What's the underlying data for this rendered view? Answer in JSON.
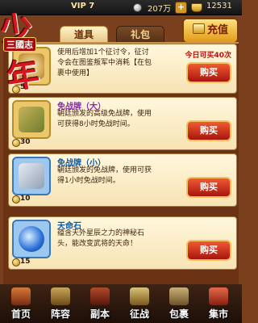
{
  "logo": {
    "main": "少年",
    "sub": "三國志"
  },
  "topbar": {
    "vip": "VIP 7",
    "silver": "207万",
    "plus_silver": "+",
    "gold": "12531"
  },
  "tabs": {
    "props": "道具",
    "gift": "礼包"
  },
  "recharge_label": "充值",
  "items": [
    {
      "name": "",
      "desc": "使用后增加1个征讨令，征讨令会在图鉴叛军中消耗【在包裹中使用】",
      "count": "5",
      "limit": "今日可买40次",
      "buy": "购买"
    },
    {
      "name": "免战牌（大）",
      "desc": "朝廷颁发的高级免战牌，使用可获得8小时免战时间。",
      "count": "30",
      "limit": "",
      "buy": "购买"
    },
    {
      "name": "免战牌（小）",
      "desc": "朝廷颁发的免战牌，使用可获得1小时免战时间。",
      "count": "10",
      "limit": "",
      "buy": "购买"
    },
    {
      "name": "天命石",
      "desc": "蕴含天外星辰之力的神秘石头，能改变武将的天命！",
      "count": "15",
      "limit": "",
      "buy": "购买"
    }
  ],
  "nav": [
    {
      "label": "首页",
      "icon": "home-icon"
    },
    {
      "label": "阵容",
      "icon": "lineup-icon"
    },
    {
      "label": "副本",
      "icon": "dungeon-icon"
    },
    {
      "label": "征战",
      "icon": "battle-icon"
    },
    {
      "label": "包裹",
      "icon": "bag-icon"
    },
    {
      "label": "集市",
      "icon": "market-icon"
    }
  ]
}
